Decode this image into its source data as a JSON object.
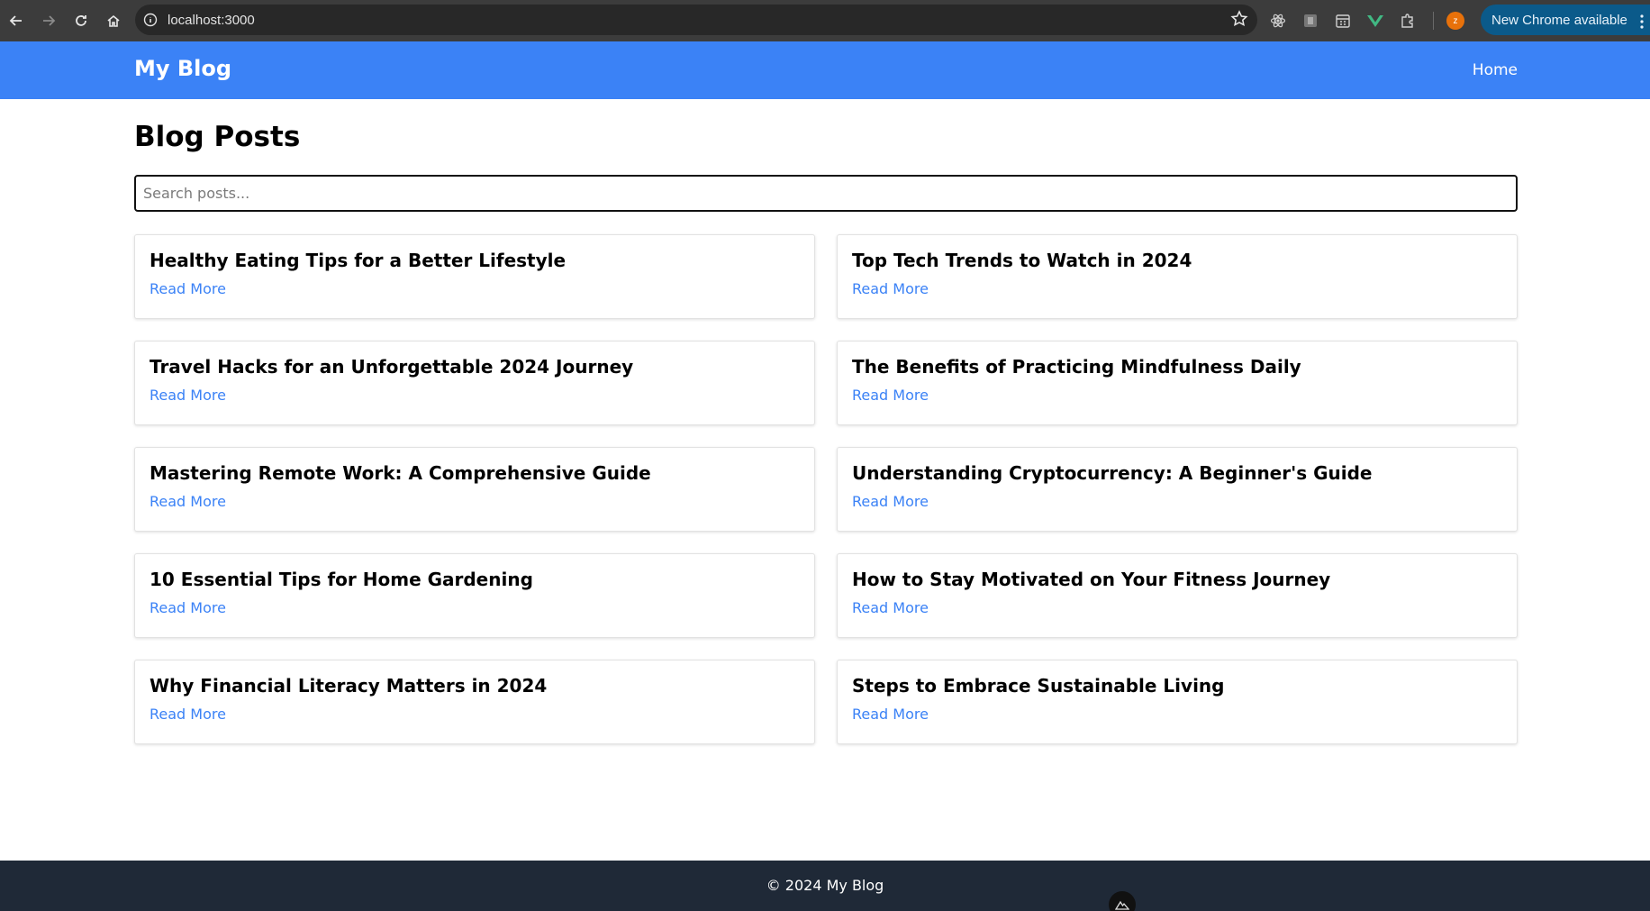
{
  "browser": {
    "url": "localhost:3000",
    "update_label": "New Chrome available",
    "profile_initial": "z"
  },
  "header": {
    "brand": "My Blog",
    "nav_home": "Home",
    "bg_color": "#3b82f6"
  },
  "main": {
    "title": "Blog Posts",
    "search_placeholder": "Search posts...",
    "read_more_label": "Read More",
    "posts": [
      {
        "title": "Healthy Eating Tips for a Better Lifestyle"
      },
      {
        "title": "Top Tech Trends to Watch in 2024"
      },
      {
        "title": "Travel Hacks for an Unforgettable 2024 Journey"
      },
      {
        "title": "The Benefits of Practicing Mindfulness Daily"
      },
      {
        "title": "Mastering Remote Work: A Comprehensive Guide"
      },
      {
        "title": "Understanding Cryptocurrency: A Beginner's Guide"
      },
      {
        "title": "10 Essential Tips for Home Gardening"
      },
      {
        "title": "How to Stay Motivated on Your Fitness Journey"
      },
      {
        "title": "Why Financial Literacy Matters in 2024"
      },
      {
        "title": "Steps to Embrace Sustainable Living"
      }
    ]
  },
  "footer": {
    "text": "© 2024 My Blog",
    "bg_color": "#1f2937"
  },
  "icons": [
    "back-arrow-icon",
    "forward-arrow-icon",
    "reload-icon",
    "home-icon",
    "site-info-icon",
    "bookmark-star-icon",
    "react-devtools-icon",
    "extension-icon",
    "calendar-icon",
    "vue-devtools-icon",
    "puzzle-extensions-icon",
    "kebab-menu-icon",
    "nuxt-devtools-icon"
  ]
}
